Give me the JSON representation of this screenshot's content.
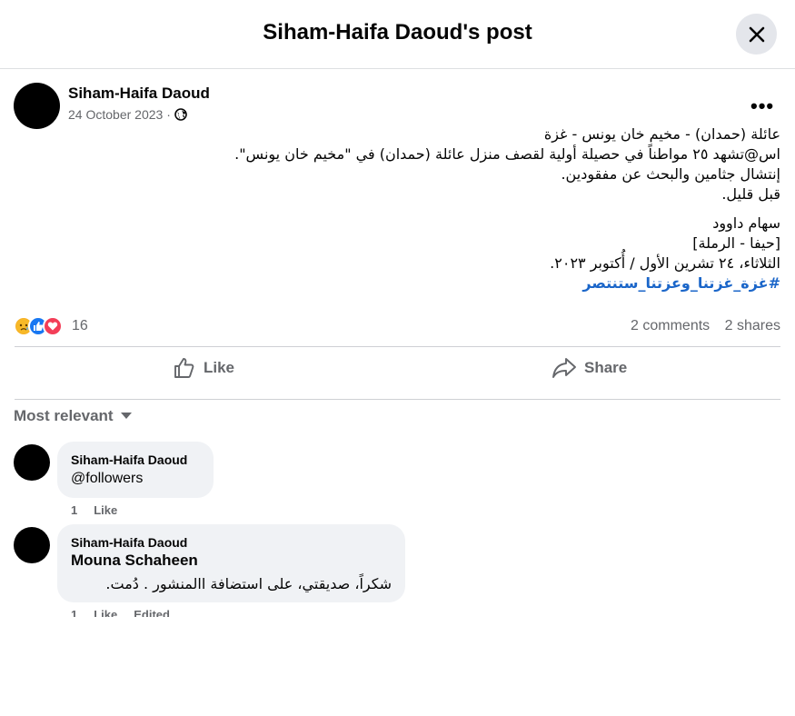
{
  "header": {
    "title": "Siham-Haifa Daoud's post",
    "close_label": "✕"
  },
  "post": {
    "author": "Siham-Haifa Daoud",
    "date": "24 October 2023",
    "audience_sep": "·",
    "more_label": "•••",
    "body_lines": [
      "عائلة (حمدان) - مخيم خان يونس - غزة",
      "اس@تشهد ٢٥ مواطناً في حصيلة أولية لقصف منزل عائلة (حمدان) في \"مخيم خان يونس\".",
      "إنتشال جثامين والبحث عن مفقودين.",
      "قبل قليل."
    ],
    "signature_lines": [
      "سهام داوود",
      "[حيفا - الرملة]",
      "الثلاثاء، ٢٤ تشرين الأول / أُكتوبر ٢٠٢٣."
    ],
    "hashtag": "#غزة_غزتنا_وعزتنا_ستنتصر",
    "reaction_count": "16",
    "comments_count": "2 comments",
    "shares_count": "2 shares",
    "like_label": "Like",
    "share_label": "Share"
  },
  "comments_section": {
    "sort_label": "Most relevant",
    "comments": [
      {
        "author": "Siham-Haifa Daoud",
        "text": "@followers",
        "like_count": "1",
        "like_label": "Like"
      },
      {
        "author": "Siham-Haifa Daoud",
        "mention": "Mouna Schaheen",
        "text": "شكراً، صديقتي، على استضافة االمنشور . دُمت.",
        "like_count": "1",
        "like_label": "Like",
        "edited_label": "Edited"
      }
    ]
  },
  "colors": {
    "link": "#1b66c9",
    "secondary_text": "#65676b",
    "bubble": "#f0f2f5"
  }
}
